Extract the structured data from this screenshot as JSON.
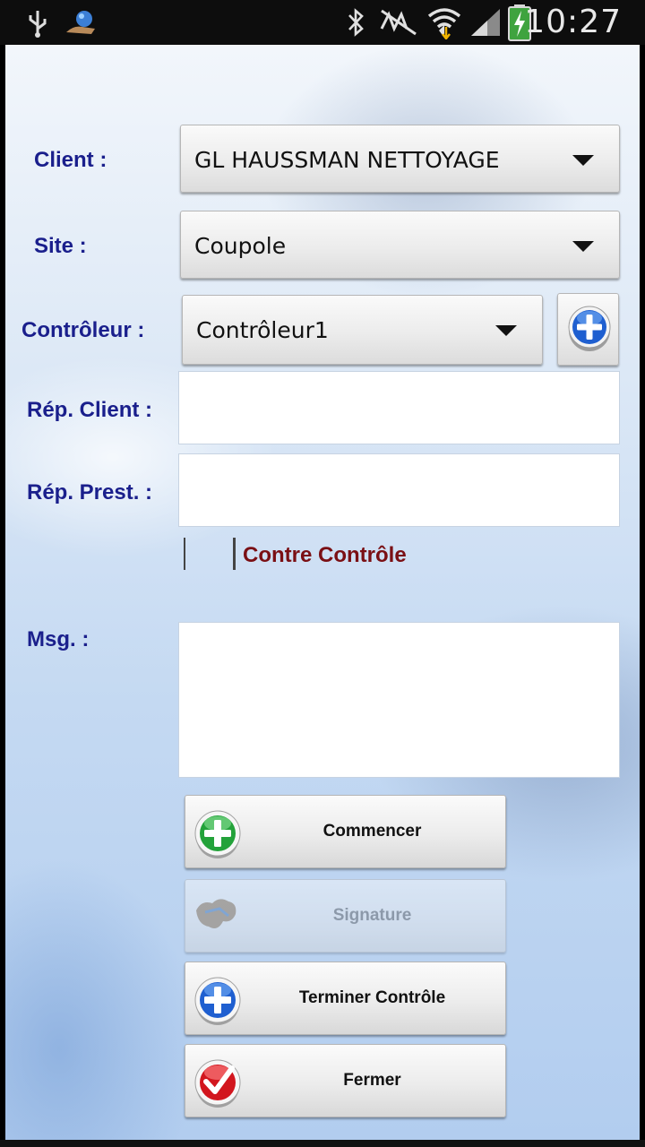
{
  "status_bar": {
    "time": "10:27",
    "icons": [
      "usb-icon",
      "notification-app-icon",
      "bluetooth-icon",
      "mute-icon",
      "wifi-icon",
      "signal-icon",
      "battery-charging-icon"
    ]
  },
  "form": {
    "client": {
      "label": "Client :",
      "value": "GL HAUSSMAN NETTOYAGE"
    },
    "site": {
      "label": "Site :",
      "value": "Coupole"
    },
    "controleur": {
      "label": "Contrôleur :",
      "value": "Contrôleur1"
    },
    "rep_client": {
      "label": "Rép. Client :",
      "value": ""
    },
    "rep_prest": {
      "label": "Rép. Prest. :",
      "value": ""
    },
    "contre_controle": {
      "label": "Contre Contrôle",
      "checked": false
    },
    "msg": {
      "label": "Msg. :",
      "value": ""
    }
  },
  "buttons": {
    "commencer": "Commencer",
    "signature": "Signature",
    "terminer": "Terminer Contrôle",
    "fermer": "Fermer"
  },
  "colors": {
    "label": "#1a1f8c",
    "contre_controle_label": "#7a0f14",
    "add_icon": "#1f5fd0",
    "commencer_icon": "#23a23a",
    "fermer_icon": "#d2161e"
  }
}
